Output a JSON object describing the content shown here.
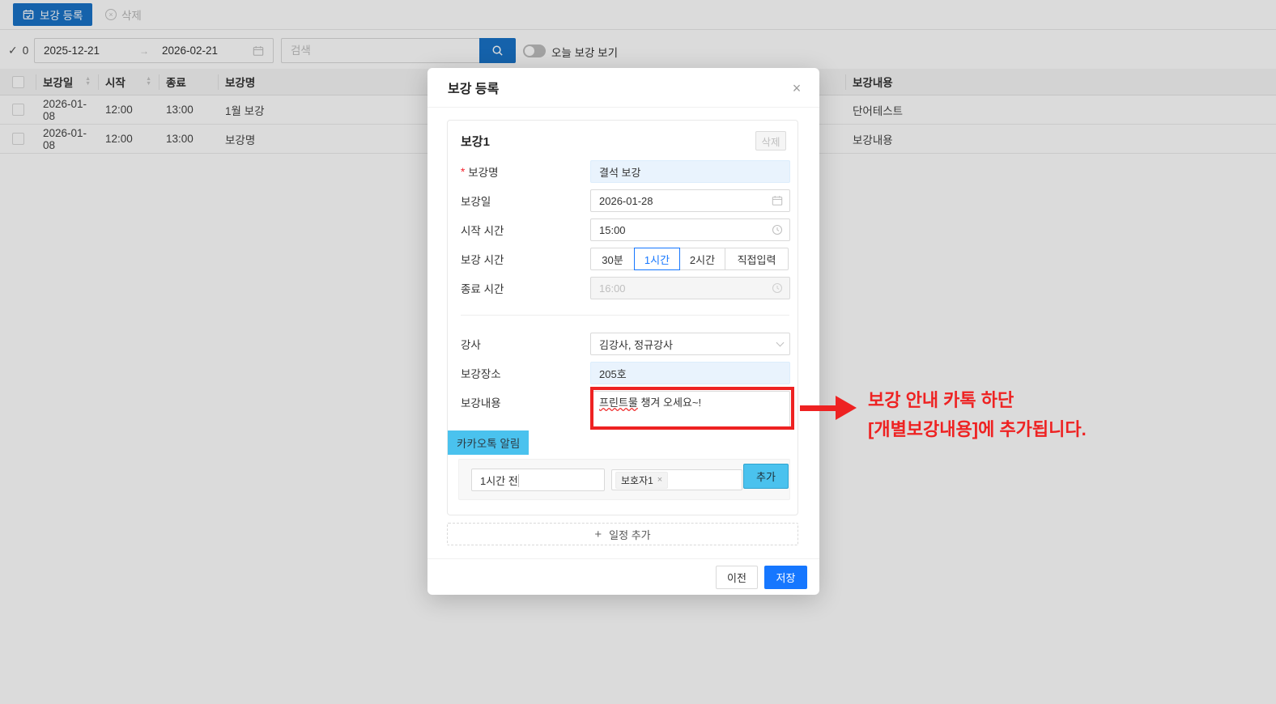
{
  "toolbar": {
    "register_label": "보강 등록",
    "delete_label": "삭제"
  },
  "filters": {
    "selected_count": "0",
    "date_start": "2025-12-21",
    "date_end": "2026-02-21",
    "search_placeholder": "검색",
    "toggle_label": "오늘 보강 보기"
  },
  "table": {
    "columns": {
      "date": "보강일",
      "start": "시작",
      "end": "종료",
      "name": "보강명",
      "content": "보강내용"
    },
    "rows": [
      {
        "date": "2026-01-08",
        "start": "12:00",
        "end": "13:00",
        "name": "1월 보강",
        "content": "단어테스트"
      },
      {
        "date": "2026-01-08",
        "start": "12:00",
        "end": "13:00",
        "name": "보강명",
        "content": "보강내용"
      }
    ]
  },
  "modal": {
    "title": "보강 등록",
    "section_title": "보강1",
    "delete_label": "삭제",
    "fields": {
      "name_label": "보강명",
      "name_value": "결석 보강",
      "date_label": "보강일",
      "date_value": "2026-01-28",
      "start_label": "시작 시간",
      "start_value": "15:00",
      "duration_label": "보강 시간",
      "duration_options": [
        "30분",
        "1시간",
        "2시간",
        "직접입력"
      ],
      "duration_selected": "1시간",
      "end_label": "종료 시간",
      "end_value": "16:00",
      "teacher_label": "강사",
      "teacher_value": "김강사, 정규강사",
      "place_label": "보강장소",
      "place_value": "205호",
      "content_label": "보강내용",
      "content_word": "프린트물",
      "content_rest": " 챙겨 오세요~!"
    },
    "kakao": {
      "label": "카카오톡 알림",
      "time_option": "1시간 전",
      "tag": "보호자1",
      "add_label": "추가"
    },
    "add_schedule_label": "일정 추가",
    "footer": {
      "prev_label": "이전",
      "save_label": "저장"
    }
  },
  "annotation": {
    "line1": "보강 안내 카톡 하단",
    "line2": "[개별보강내용]에 추가됩니다."
  },
  "icons": {
    "check": "✓",
    "range_arrow": "→",
    "caret_up": "▲",
    "caret_down": "▼",
    "close": "×",
    "tag_remove": "×",
    "circle_x": "×",
    "plus": "+"
  },
  "colors": {
    "primary_blue": "#1677ff",
    "toolbar_blue": "#1973c8",
    "cyan_highlight": "#4ac2ee",
    "annotation_red": "#ee2222",
    "field_highlight": "#e9f3fd"
  }
}
